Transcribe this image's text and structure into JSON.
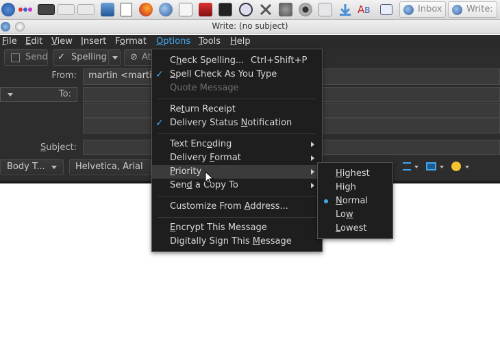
{
  "taskbar": {
    "tasks": [
      {
        "label": "Inbox"
      },
      {
        "label": "Write:"
      }
    ]
  },
  "window": {
    "title": "Write: (no subject)"
  },
  "menubar": {
    "items": [
      "File",
      "Edit",
      "View",
      "Insert",
      "Format",
      "Options",
      "Tools",
      "Help"
    ],
    "active": "Options"
  },
  "toolbar": {
    "send": "Send",
    "spelling": "Spelling",
    "attach": "At"
  },
  "compose": {
    "from_label": "From:",
    "from_value": "martin <marti",
    "to_label": "To:",
    "subject_label": "Subject:",
    "paragraph_style": "Body T...",
    "font": "Helvetica, Arial"
  },
  "options_menu": {
    "check_spelling": "Check Spelling...",
    "check_spelling_shortcut": "Ctrl+Shift+P",
    "spell_as_you_type": "Spell Check As You Type",
    "quote_message": "Quote Message",
    "return_receipt": "Return Receipt",
    "delivery_status": "Delivery Status Notification",
    "text_encoding": "Text Encoding",
    "delivery_format": "Delivery Format",
    "priority": "Priority",
    "send_copy_to": "Send a Copy To",
    "customize_from": "Customize From Address...",
    "encrypt": "Encrypt This Message",
    "sign": "Digitally Sign This Message"
  },
  "priority_menu": {
    "items": [
      "Highest",
      "High",
      "Normal",
      "Low",
      "Lowest"
    ],
    "selected": "Normal"
  },
  "colors": {
    "accent": "#3fa9f5",
    "menu_bg": "#1e1e1e",
    "app_bg": "#2d2d2d"
  }
}
